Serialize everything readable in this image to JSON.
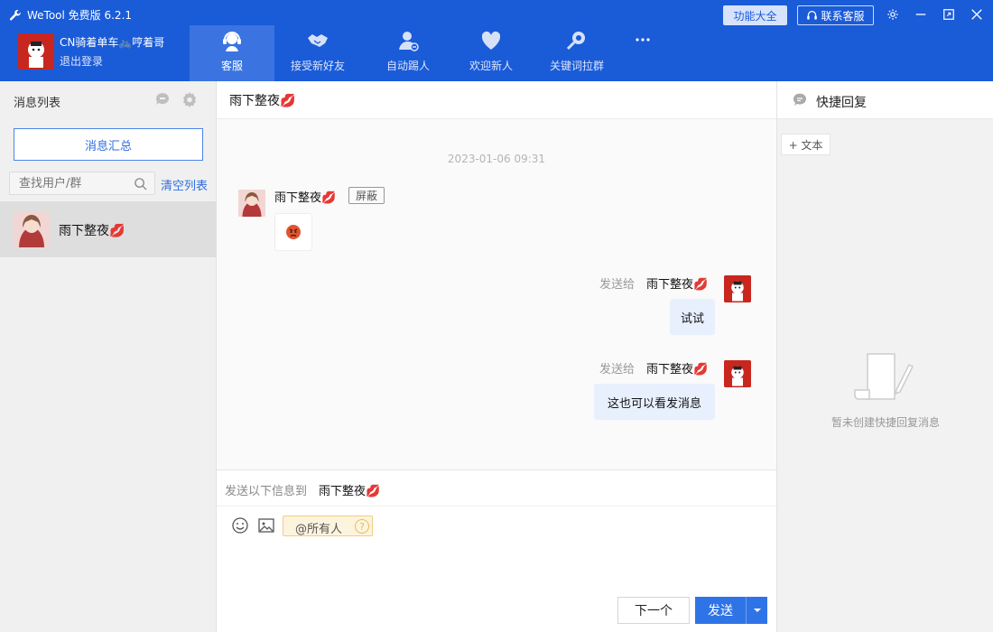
{
  "app": {
    "title": "WeTool 免费版 6.2.1",
    "features_btn": "功能大全",
    "support_btn": "联系客服"
  },
  "account": {
    "name": "CN骑着单车🚲哼着哥",
    "logout": "退出登录"
  },
  "nav": [
    {
      "label": "客服",
      "icon": "headset-icon"
    },
    {
      "label": "接受新好友",
      "icon": "handshake-icon"
    },
    {
      "label": "自动踢人",
      "icon": "user-remove-icon"
    },
    {
      "label": "欢迎新人",
      "icon": "heart-icon"
    },
    {
      "label": "关键词拉群",
      "icon": "search-key-icon"
    },
    {
      "label": "",
      "icon": "more-icon"
    }
  ],
  "left": {
    "title": "消息列表",
    "summary_btn": "消息汇总",
    "search_placeholder": "查找用户/群",
    "clear_link": "清空列表",
    "contact_name": "雨下整夜💋"
  },
  "chat": {
    "title": "雨下整夜💋",
    "timestamp": "2023-01-06 09:31",
    "incoming_sender": "雨下整夜💋",
    "block_btn": "屏蔽",
    "sent_label": "发送给",
    "recipient": "雨下整夜💋",
    "messages": [
      "试试",
      "这也可以看发消息"
    ]
  },
  "compose": {
    "to_label": "发送以下信息到",
    "to_name": "雨下整夜💋",
    "at_all": "@所有人",
    "help": "?",
    "next_btn": "下一个",
    "send_btn": "发送"
  },
  "right": {
    "title": "快捷回复",
    "tag_text": "+ 文本",
    "empty_text": "暂未创建快捷回复消息"
  },
  "colors": {
    "header_blue": "#1a5bd8",
    "nav_active": "#3b74e0",
    "send_blue": "#2f74e6",
    "bubble_out": "#e8f0fd"
  }
}
